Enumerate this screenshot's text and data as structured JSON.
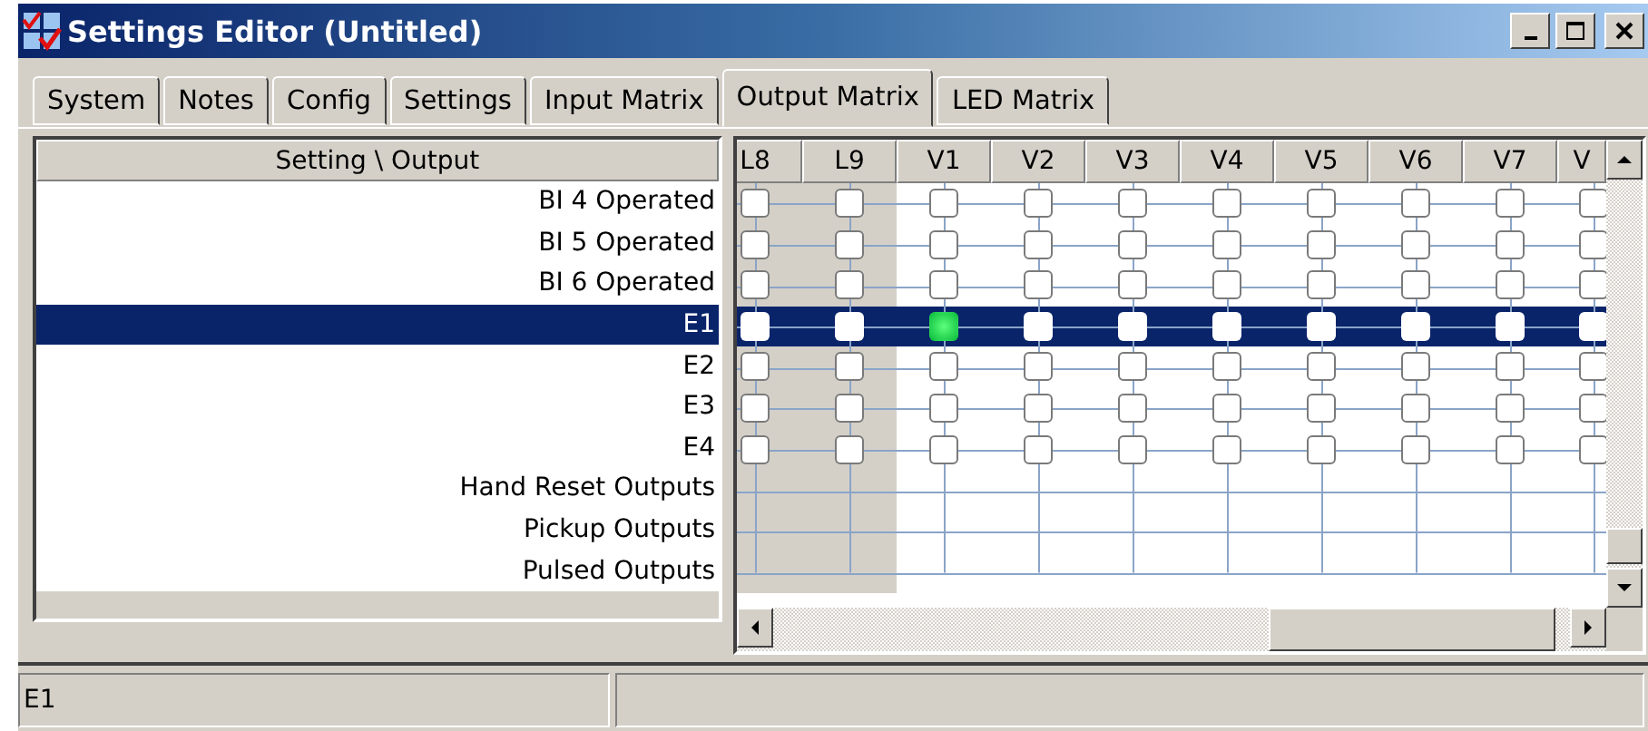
{
  "window": {
    "title": "Settings Editor (Untitled)"
  },
  "tabs": [
    {
      "label": "System",
      "selected": false
    },
    {
      "label": "Notes",
      "selected": false
    },
    {
      "label": "Config",
      "selected": false
    },
    {
      "label": "Settings",
      "selected": false
    },
    {
      "label": "Input Matrix",
      "selected": false
    },
    {
      "label": "Output Matrix",
      "selected": true
    },
    {
      "label": "LED Matrix",
      "selected": false
    }
  ],
  "settings_header": "Setting \\ Output",
  "columns": [
    {
      "label": "L8",
      "disabled": true
    },
    {
      "label": "L9",
      "disabled": true
    },
    {
      "label": "V1",
      "disabled": false
    },
    {
      "label": "V2",
      "disabled": false
    },
    {
      "label": "V3",
      "disabled": false
    },
    {
      "label": "V4",
      "disabled": false
    },
    {
      "label": "V5",
      "disabled": false
    },
    {
      "label": "V6",
      "disabled": false
    },
    {
      "label": "V7",
      "disabled": false
    },
    {
      "label": "V",
      "disabled": false
    }
  ],
  "rows": [
    {
      "label": "BI 4 Operated",
      "selected": false,
      "kind": "checkbox",
      "checked": [
        false,
        false,
        false,
        false,
        false,
        false,
        false,
        false,
        false,
        false
      ]
    },
    {
      "label": "BI 5 Operated",
      "selected": false,
      "kind": "checkbox",
      "checked": [
        false,
        false,
        false,
        false,
        false,
        false,
        false,
        false,
        false,
        false
      ]
    },
    {
      "label": "BI 6 Operated",
      "selected": false,
      "kind": "checkbox",
      "checked": [
        false,
        false,
        false,
        false,
        false,
        false,
        false,
        false,
        false,
        false
      ]
    },
    {
      "label": "E1",
      "selected": true,
      "kind": "checkbox",
      "checked": [
        false,
        false,
        true,
        false,
        false,
        false,
        false,
        false,
        false,
        false
      ]
    },
    {
      "label": "E2",
      "selected": false,
      "kind": "checkbox",
      "checked": [
        false,
        false,
        false,
        false,
        false,
        false,
        false,
        false,
        false,
        false
      ]
    },
    {
      "label": "E3",
      "selected": false,
      "kind": "checkbox",
      "checked": [
        false,
        false,
        false,
        false,
        false,
        false,
        false,
        false,
        false,
        false
      ]
    },
    {
      "label": "E4",
      "selected": false,
      "kind": "checkbox",
      "checked": [
        false,
        false,
        false,
        false,
        false,
        false,
        false,
        false,
        false,
        false
      ]
    },
    {
      "label": "Hand Reset Outputs",
      "selected": false,
      "kind": "group"
    },
    {
      "label": "Pickup Outputs",
      "selected": false,
      "kind": "group"
    },
    {
      "label": "Pulsed Outputs",
      "selected": false,
      "kind": "group"
    }
  ],
  "status_bar": {
    "text": "E1"
  }
}
